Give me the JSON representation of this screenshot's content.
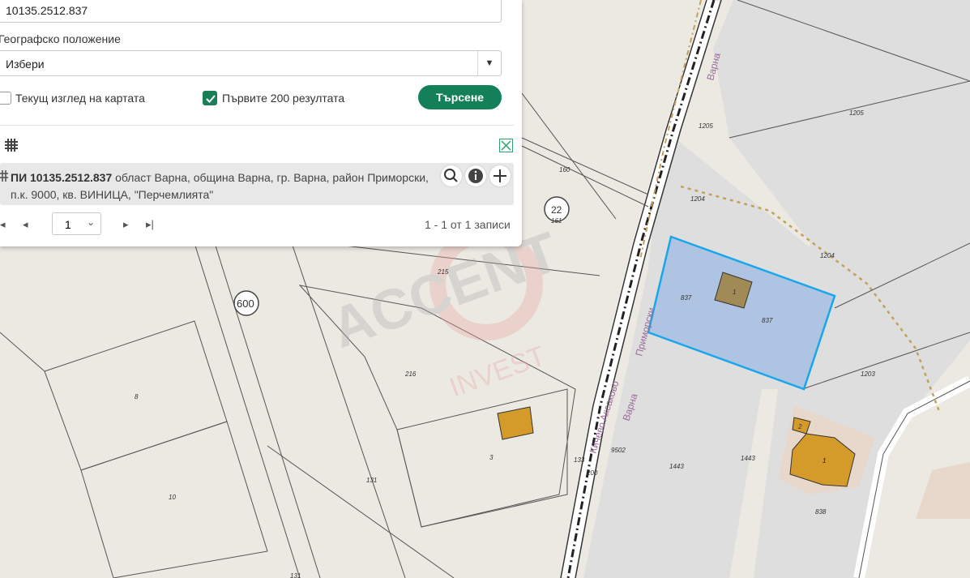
{
  "form": {
    "id_value": "10135.2512.837",
    "location_label": "Географско положение",
    "location_select": "Избери",
    "current_view_label": "Текущ изглед на картата",
    "first200_label": "Първите 200 резултата",
    "search_label": "Търсене"
  },
  "result": {
    "bold": "ПИ 10135.2512.837",
    "rest": "област Варна, община Варна, гр. Варна, район Приморски, п.к. 9000, кв. ВИНИЦА, \"Перчемлията\""
  },
  "pager": {
    "page": "1",
    "summary": "1 - 1 от 1 записи"
  },
  "map": {
    "labels": [
      "1205",
      "1205",
      "160",
      "1204",
      "161",
      "1204",
      "215",
      "837",
      "837",
      "1",
      "216",
      "1203",
      "3",
      "1",
      "131",
      "133",
      "200",
      "9502",
      "1443",
      "1443",
      "2",
      "1",
      "838",
      "8",
      "10",
      "131",
      "22",
      "600"
    ],
    "streets": [
      "Варна",
      "Приморски",
      "Аксаково",
      "Варна",
      "Кичево"
    ],
    "watermark": [
      "ACCENT",
      "INVEST"
    ]
  },
  "colors": {
    "accent": "#148059",
    "parcel": "#3aa8e8",
    "building": "#d49a2a"
  }
}
